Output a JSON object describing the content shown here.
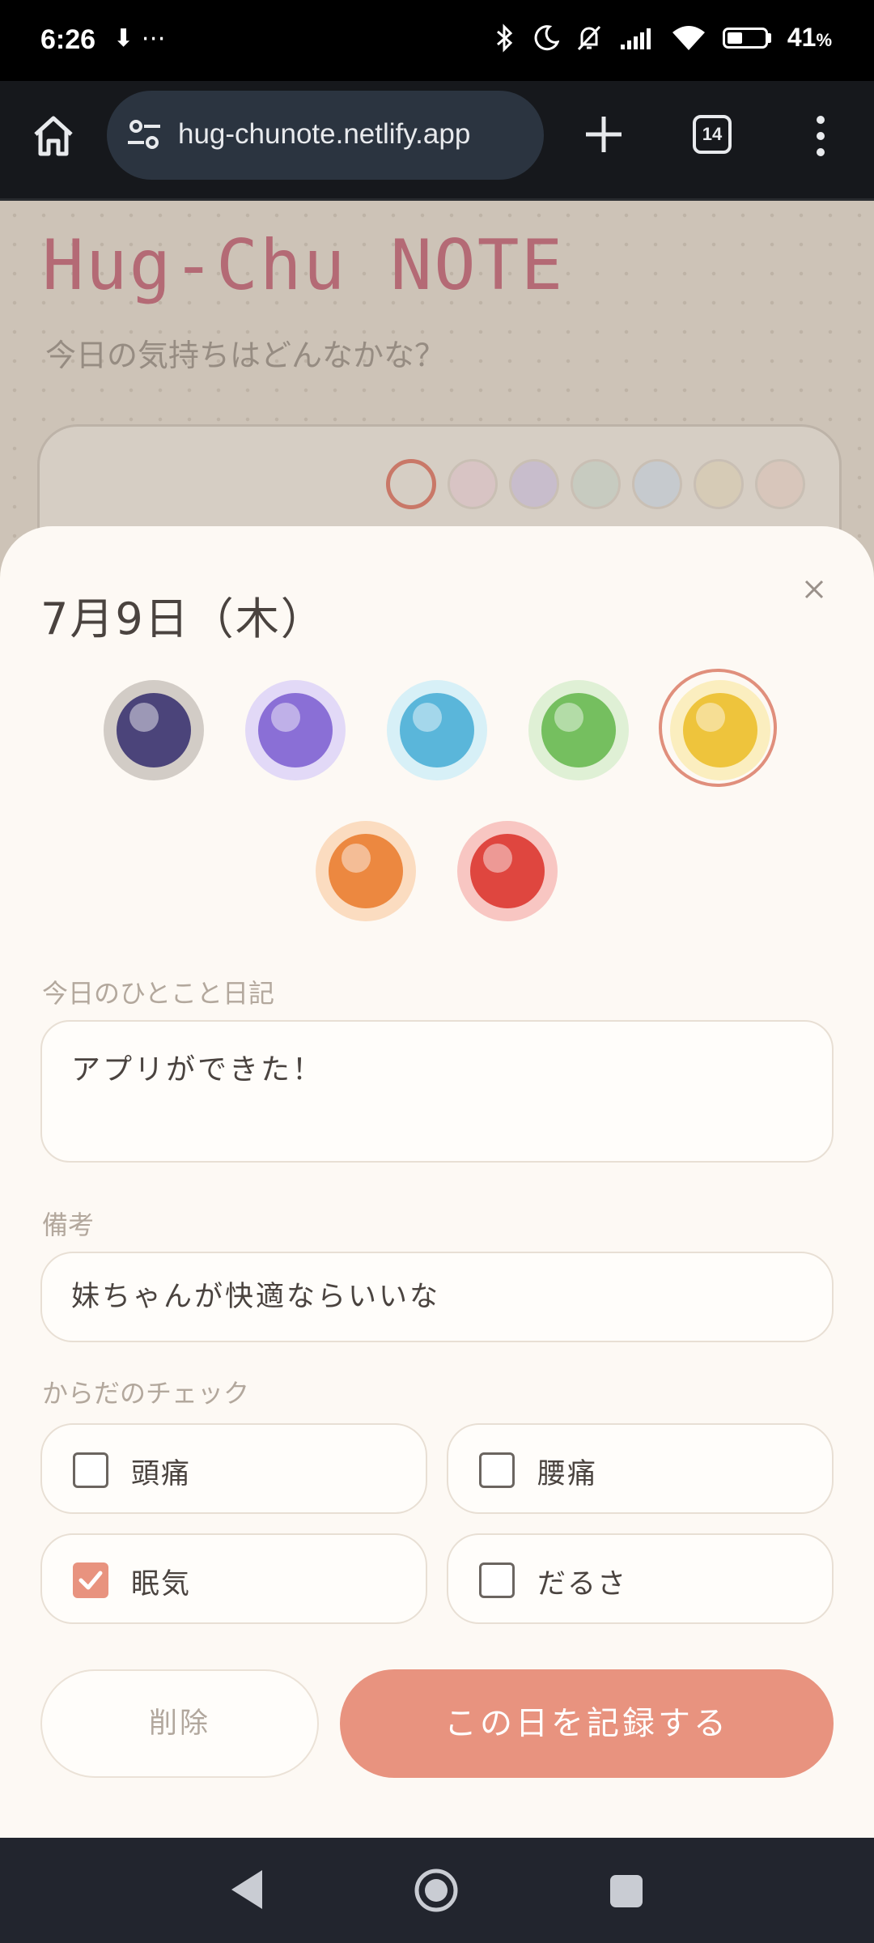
{
  "status_bar": {
    "time": "6:26",
    "left_icons": "⬇ ⋯",
    "battery": "41",
    "battery_unit": "%"
  },
  "browser": {
    "url": "hug-chunote.netlify.app",
    "tab_count": "14"
  },
  "app": {
    "title": "Hug-Chu NOTE",
    "subtitle": "今日の気持ちはどんなかな？"
  },
  "sheet": {
    "date": "7月9日（木）",
    "moods": [
      {
        "name": "mood-navy",
        "color": "#4b447a",
        "ring": "#d2ccc6",
        "selected": false
      },
      {
        "name": "mood-purple",
        "color": "#8a6fd6",
        "ring": "#e2d9f7",
        "selected": false
      },
      {
        "name": "mood-blue",
        "color": "#5ab6da",
        "ring": "#d7f0f7",
        "selected": false
      },
      {
        "name": "mood-green",
        "color": "#75bf5f",
        "ring": "#dff0d5",
        "selected": false
      },
      {
        "name": "mood-yellow",
        "color": "#eec43c",
        "ring": "#fbeebf",
        "selected": true
      },
      {
        "name": "mood-orange",
        "color": "#ec8840",
        "ring": "#fbdcc0",
        "selected": false
      },
      {
        "name": "mood-red",
        "color": "#df463f",
        "ring": "#f8c6c2",
        "selected": false
      }
    ],
    "diary_label": "今日のひとこと日記",
    "diary_value": "アプリができた！",
    "notes_label": "備考",
    "notes_value": "妹ちゃんが快適ならいいな",
    "body_check_label": "からだのチェック",
    "checks": [
      {
        "label": "頭痛",
        "checked": false
      },
      {
        "label": "腰痛",
        "checked": false
      },
      {
        "label": "眠気",
        "checked": true
      },
      {
        "label": "だるさ",
        "checked": false
      }
    ],
    "delete_label": "削除",
    "save_label": "この日を記録する"
  },
  "colors": {
    "accent": "#e8937f",
    "title_pink": "#b46a75"
  }
}
